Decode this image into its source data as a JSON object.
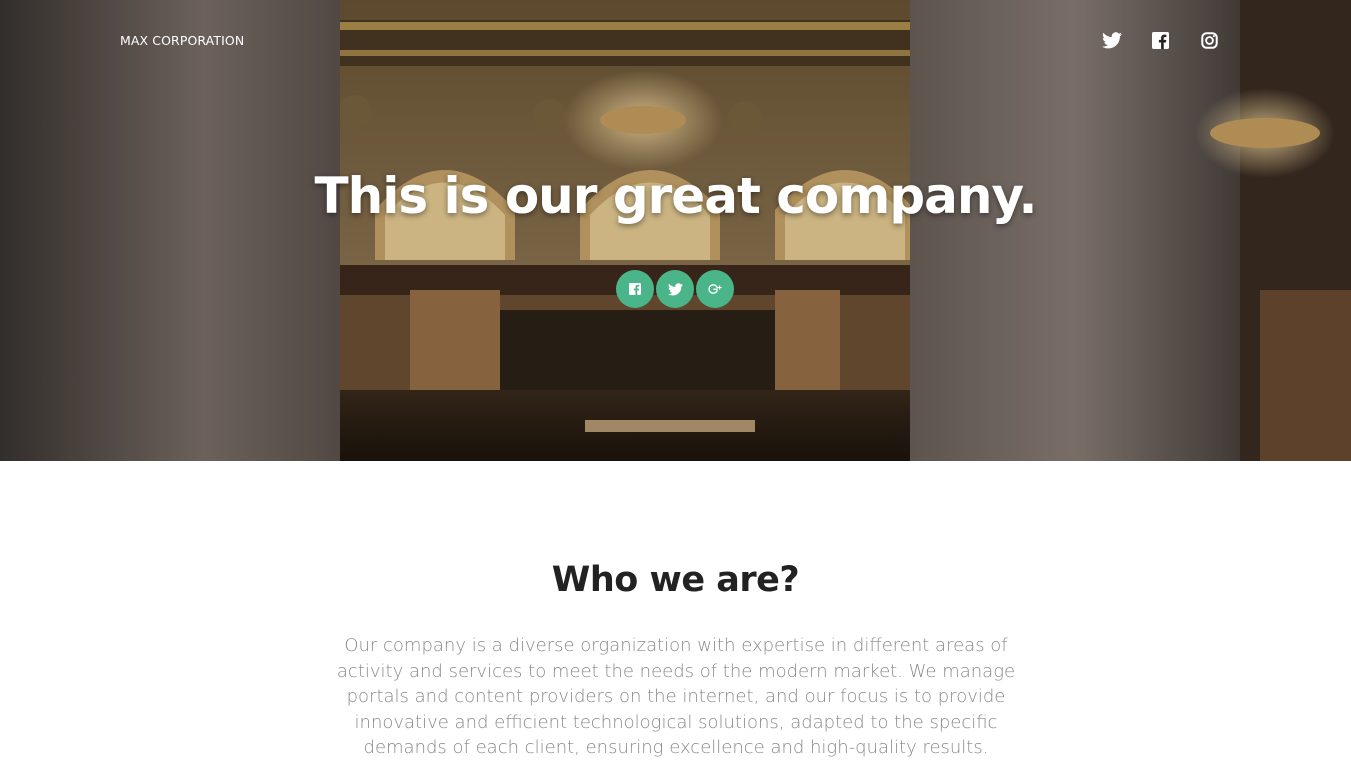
{
  "header": {
    "brand": "MAX CORPORATION",
    "social_icons": [
      "twitter-icon",
      "facebook-icon",
      "instagram-icon"
    ]
  },
  "hero": {
    "title": "This is our great company.",
    "share_icons": [
      "facebook-icon",
      "twitter-icon",
      "google-plus-icon"
    ],
    "share_color": "#4bb58a"
  },
  "about": {
    "title": "Who we are?",
    "text": "Our company is a diverse organization with expertise in different areas of activity and services to meet the needs of the modern market. We manage portals and content providers on the internet, and our focus is to provide innovative and efficient technological solutions, adapted to the specific demands of each client, ensuring excellence and high-quality results."
  }
}
